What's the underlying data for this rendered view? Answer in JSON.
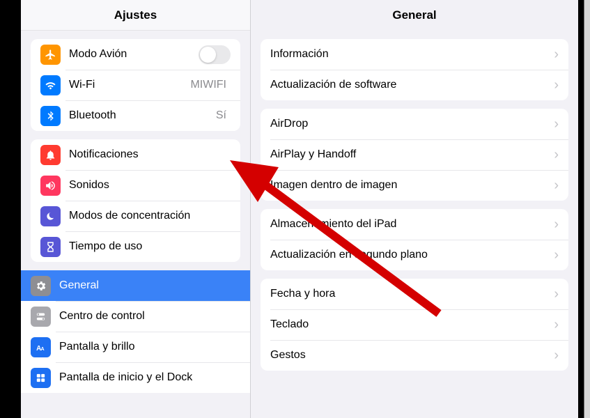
{
  "sidebar": {
    "title": "Ajustes",
    "groups": [
      {
        "rows": [
          {
            "id": "airplane",
            "icon": "airplane-icon",
            "bg": "bg-orange",
            "label": "Modo Avión",
            "control": "toggle",
            "toggle_on": false
          },
          {
            "id": "wifi",
            "icon": "wifi-icon",
            "bg": "bg-blue",
            "label": "Wi-Fi",
            "value": "MIWIFI"
          },
          {
            "id": "bluetooth",
            "icon": "bluetooth-icon",
            "bg": "bg-blue",
            "label": "Bluetooth",
            "value": "Sí"
          }
        ]
      },
      {
        "rows": [
          {
            "id": "notifications",
            "icon": "bell-icon",
            "bg": "bg-red",
            "label": "Notificaciones"
          },
          {
            "id": "sounds",
            "icon": "speaker-icon",
            "bg": "bg-pink",
            "label": "Sonidos"
          },
          {
            "id": "focus",
            "icon": "moon-icon",
            "bg": "bg-indigo",
            "label": "Modos de concentración"
          },
          {
            "id": "screentime",
            "icon": "hourglass-icon",
            "bg": "bg-indigo",
            "label": "Tiempo de uso"
          }
        ]
      },
      {
        "flat": true,
        "rows": [
          {
            "id": "general",
            "icon": "gear-icon",
            "bg": "bg-gray",
            "label": "General",
            "selected": true
          },
          {
            "id": "controlcenter",
            "icon": "switches-icon",
            "bg": "bg-graylight",
            "label": "Centro de control"
          },
          {
            "id": "display",
            "icon": "text-icon",
            "bg": "bg-bluedark",
            "label": "Pantalla y brillo"
          },
          {
            "id": "homescreen",
            "icon": "grid-icon",
            "bg": "bg-bluedark",
            "label": "Pantalla de inicio y el Dock"
          }
        ]
      }
    ]
  },
  "main": {
    "title": "General",
    "groups": [
      {
        "rows": [
          {
            "id": "info",
            "label": "Información"
          },
          {
            "id": "software",
            "label": "Actualización de software"
          }
        ]
      },
      {
        "rows": [
          {
            "id": "airdrop",
            "label": "AirDrop"
          },
          {
            "id": "airplay",
            "label": "AirPlay y Handoff"
          },
          {
            "id": "pip",
            "label": "Imagen dentro de imagen"
          }
        ]
      },
      {
        "rows": [
          {
            "id": "storage",
            "label": "Almacenamiento del iPad"
          },
          {
            "id": "bgrefresh",
            "label": "Actualización en segundo plano"
          }
        ]
      },
      {
        "rows": [
          {
            "id": "datetime",
            "label": "Fecha y hora"
          },
          {
            "id": "keyboard",
            "label": "Teclado"
          },
          {
            "id": "gestures",
            "label": "Gestos"
          }
        ]
      }
    ]
  }
}
